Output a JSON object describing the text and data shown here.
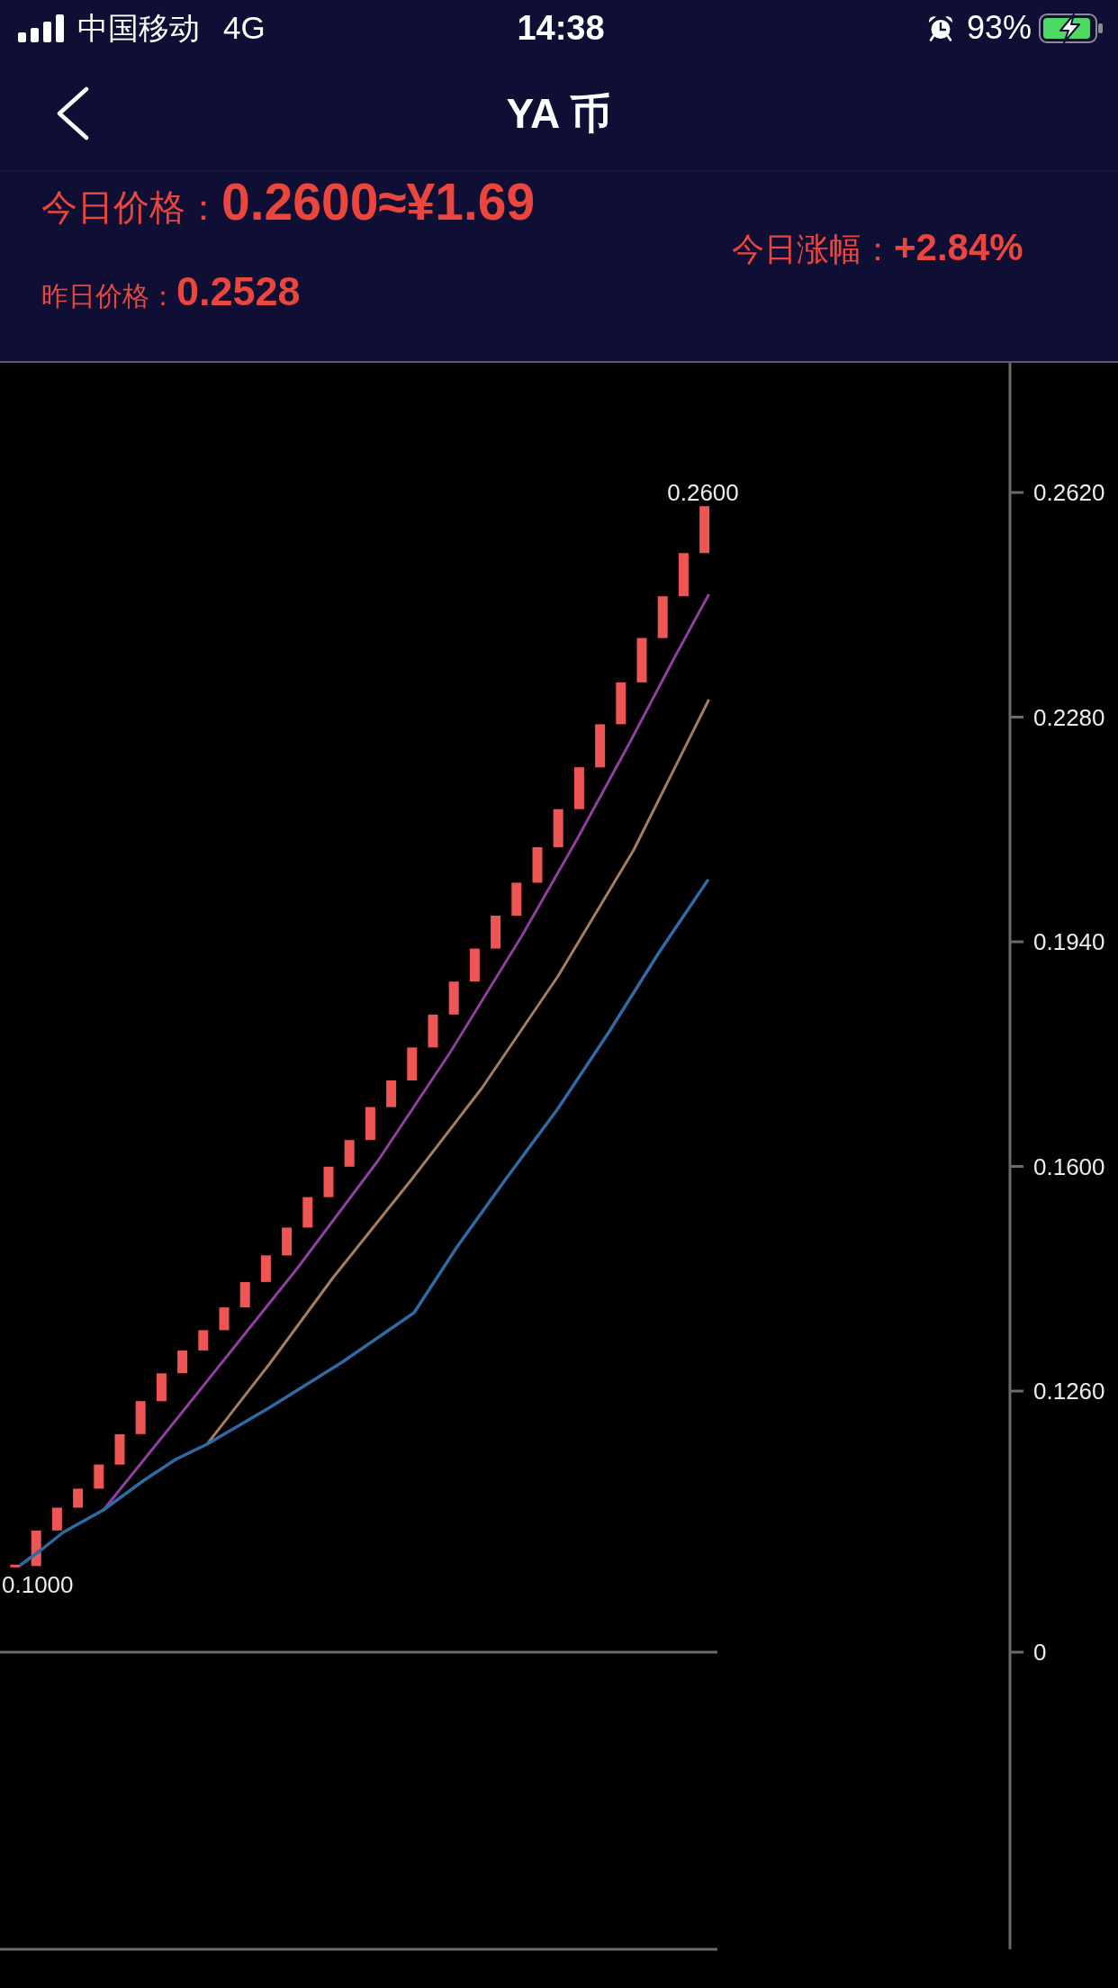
{
  "status_bar": {
    "carrier": "中国移动",
    "network": "4G",
    "time": "14:38",
    "battery": "93%"
  },
  "nav_bar": {
    "title": "YA 币"
  },
  "price_summary": {
    "today_price_label": "今日价格：",
    "today_price": "0.2600≈¥1.69",
    "yesterday_price_label": "昨日价格：",
    "yesterday_price": "0.2528",
    "change_label": "今日涨幅：",
    "change": "+2.84%"
  },
  "chart": {
    "high_label": "0.2600",
    "low_label": "0.1000",
    "price_ticks": [
      "0.2620",
      "0.2280",
      "0.1940",
      "0.1600",
      "0.1260"
    ],
    "volume_tick": "0"
  }
}
